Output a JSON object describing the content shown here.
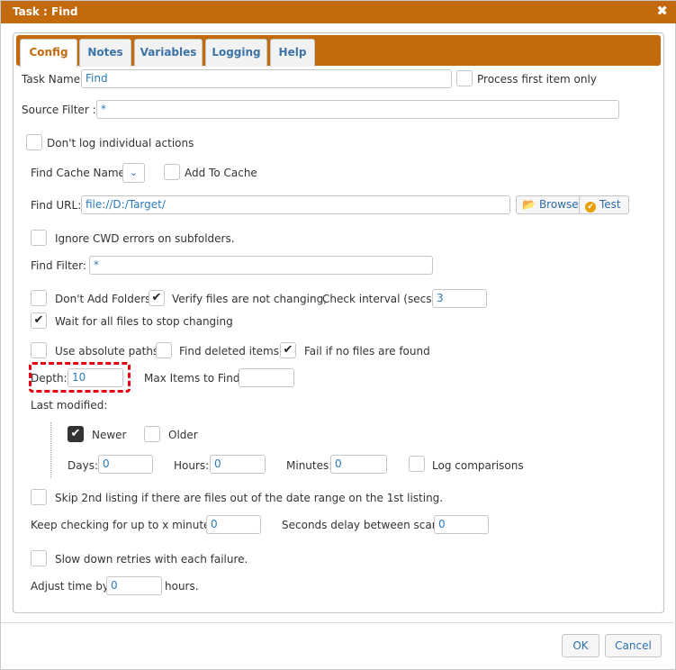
{
  "dialog": {
    "title": "Task : Find",
    "close_glyph": "✖"
  },
  "tabs": [
    {
      "label": "Config",
      "active": true
    },
    {
      "label": "Notes"
    },
    {
      "label": "Variables"
    },
    {
      "label": "Logging"
    },
    {
      "label": "Help"
    }
  ],
  "form": {
    "task_name_label": "Task Name:",
    "task_name_value": "Find",
    "process_first_label": "Process first item only",
    "source_filter_label": "Source Filter :",
    "source_filter_value": "*",
    "dont_log_label": "Don't log individual actions",
    "find_cache_name_label": "Find Cache Name:",
    "find_cache_select_glyph": "⌄",
    "add_to_cache_label": "Add To Cache",
    "find_url_label": "Find URL:",
    "find_url_value": "file://D:/Target/",
    "browse_label": "Browse",
    "test_label": "Test",
    "ignore_cwd_label": "Ignore CWD errors on subfolders.",
    "find_filter_label": "Find Filter:",
    "find_filter_value": "*",
    "dont_add_folders_label": "Don't Add Folders",
    "verify_files_label": "Verify files are not changing,",
    "check_interval_label": "Check interval (secs):",
    "check_interval_value": "3",
    "wait_all_label": "Wait for all files to stop changing",
    "use_absolute_label": "Use absolute paths",
    "find_deleted_label": "Find deleted items",
    "fail_no_files_label": "Fail if no files are found",
    "depth_label": "Depth:",
    "depth_value": "10",
    "max_items_label": "Max Items to Find:",
    "max_items_value": "",
    "last_modified_label": "Last modified:",
    "newer_label": "Newer",
    "older_label": "Older",
    "days_label": "Days:",
    "days_value": "0",
    "hours_label": "Hours:",
    "hours_value": "0",
    "minutes_label": "Minutes:",
    "minutes_value": "0",
    "log_comparisons_label": "Log comparisons",
    "skip_2nd_label": "Skip 2nd listing if there are files out of the date range on the 1st listing.",
    "keep_checking_label": "Keep checking for up to x minutes:",
    "keep_checking_value": "0",
    "seconds_delay_label": "Seconds delay between scans:",
    "seconds_delay_value": "0",
    "slow_down_label": "Slow down retries with each failure.",
    "adjust_time_label": "Adjust time by",
    "adjust_time_value": "0",
    "hours_suffix": "hours."
  },
  "checks": {
    "process_first": false,
    "dont_log": false,
    "add_to_cache": false,
    "ignore_cwd": false,
    "dont_add_folders": false,
    "verify_files": true,
    "wait_all": true,
    "use_absolute": false,
    "find_deleted": false,
    "fail_no_files": true,
    "newer": true,
    "older": false,
    "log_comparisons": false,
    "skip_2nd": false,
    "slow_down": false
  },
  "footer": {
    "ok_label": "OK",
    "cancel_label": "Cancel"
  },
  "icons": {
    "check_glyph": "✔",
    "browse_icon": "folder-open-icon",
    "test_icon": "check-circle-icon"
  },
  "colors": {
    "accent": "#c46a0e",
    "link": "#2d6ea8",
    "value": "#2d7bb8",
    "highlight": "#e60012"
  }
}
